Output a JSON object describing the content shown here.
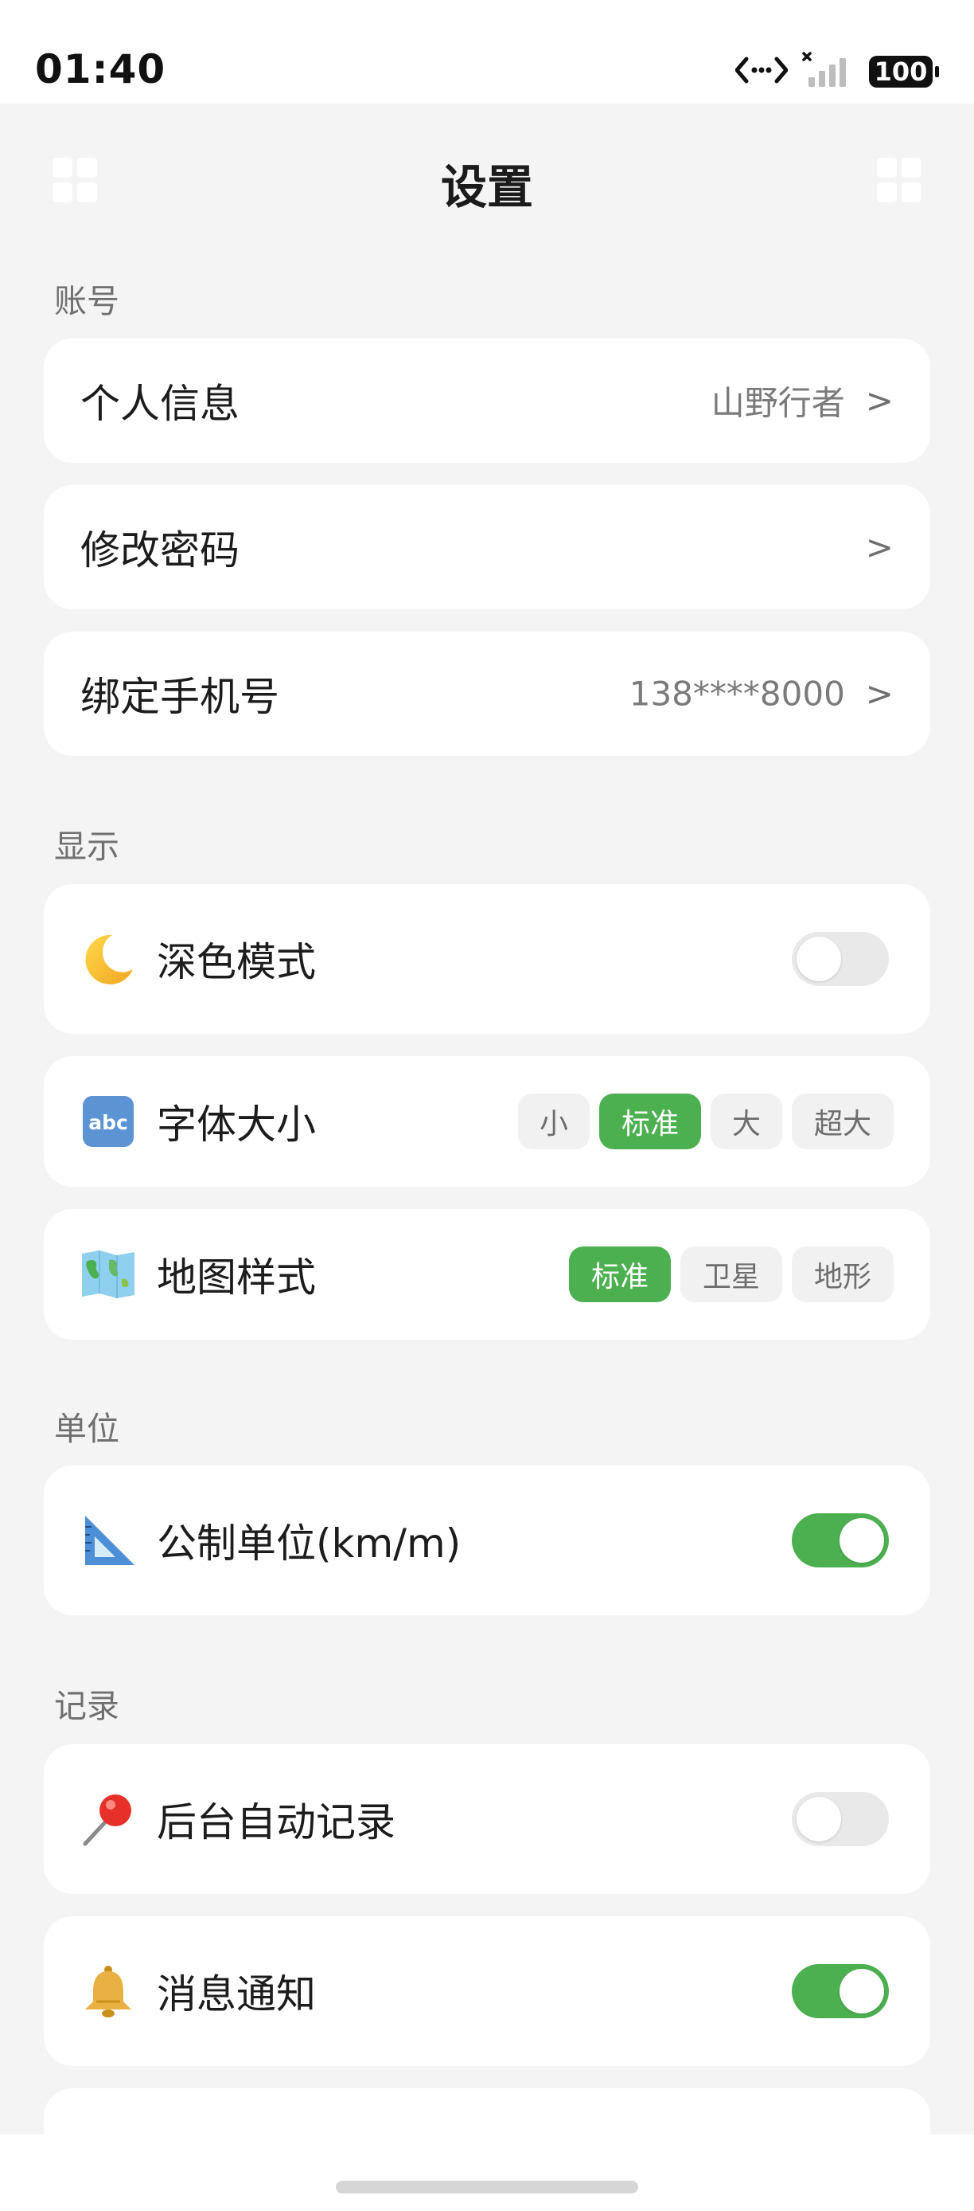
{
  "status_bar": {
    "time": "01:40",
    "battery": "100",
    "icons": [
      "data-transfer-icon",
      "signal-icon",
      "battery-icon"
    ]
  },
  "header": {
    "title": "设置",
    "left_icon": "grid-icon",
    "right_icon": "grid-icon"
  },
  "sections": {
    "account": {
      "label": "账号",
      "rows": [
        {
          "title": "个人信息",
          "value": "山野行者",
          "chevron": ">"
        },
        {
          "title": "修改密码",
          "value": "",
          "chevron": ">"
        },
        {
          "title": "绑定手机号",
          "value": "138****8000",
          "chevron": ">"
        }
      ]
    },
    "display": {
      "label": "显示",
      "dark_mode": {
        "icon": "crescent-moon-icon",
        "title": "深色模式",
        "enabled": false
      },
      "font_size": {
        "icon": "abc-icon",
        "title": "字体大小",
        "options": [
          "小",
          "标准",
          "大",
          "超大"
        ],
        "selected": "标准"
      },
      "map_style": {
        "icon": "world-map-icon",
        "title": "地图样式",
        "options": [
          "标准",
          "卫星",
          "地形"
        ],
        "selected": "标准"
      }
    },
    "units": {
      "label": "单位",
      "metric": {
        "icon": "triangular-ruler-icon",
        "title": "公制单位(km/m)",
        "enabled": true
      }
    },
    "record": {
      "label": "记录",
      "auto_record": {
        "icon": "pushpin-icon",
        "title": "后台自动记录",
        "enabled": false
      },
      "notifications": {
        "icon": "bell-icon",
        "title": "消息通知",
        "enabled": true
      }
    }
  },
  "colors": {
    "accent": "#4cb050",
    "background": "#f4f4f4",
    "card": "#ffffff",
    "toggle_off": "#e9e9e9"
  }
}
